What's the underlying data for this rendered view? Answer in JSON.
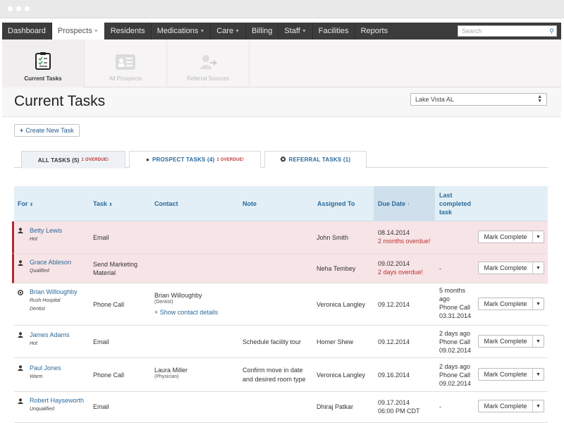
{
  "nav": {
    "items": [
      {
        "label": "Dashboard",
        "caret": false
      },
      {
        "label": "Prospects",
        "caret": true
      },
      {
        "label": "Residents",
        "caret": false
      },
      {
        "label": "Medications",
        "caret": true
      },
      {
        "label": "Care",
        "caret": true
      },
      {
        "label": "Billing",
        "caret": false
      },
      {
        "label": "Staff",
        "caret": true
      },
      {
        "label": "Facilities",
        "caret": false
      },
      {
        "label": "Reports",
        "caret": false
      }
    ],
    "search_placeholder": "Search"
  },
  "subnav": {
    "current_tasks": "Current Tasks",
    "all_prospects": "All Prospects",
    "referral_sources": "Referral Sources"
  },
  "header": {
    "title": "Current Tasks",
    "facility": "Lake Vista AL"
  },
  "create_button": "Create New Task",
  "tabs": {
    "all": {
      "label": "ALL TASKS (5)",
      "overdue": "1 OVERDUE!"
    },
    "prospect": {
      "label": "PROSPECT TASKS (4)",
      "overdue": "1 OVERDUE!"
    },
    "referral": {
      "label": "REFERRAL TASKS (1)"
    }
  },
  "table": {
    "headers": {
      "for": "For",
      "task": "Task",
      "contact": "Contact",
      "note": "Note",
      "assigned": "Assigned To",
      "due": "Due Date",
      "last1": "Last",
      "last2": "completed",
      "last3": "task"
    },
    "rows": [
      {
        "name": "Betty Lewis",
        "sub1": "Hot",
        "task1": "Email",
        "assigned": "John Smith",
        "due": "08.14.2014",
        "due_note": "2 months overdue!",
        "last": "",
        "action": "Mark Complete"
      },
      {
        "name": "Grace Ableson",
        "sub1": "Qualified",
        "task1": "Send Marketing",
        "task2": "Material",
        "assigned": "Neha Tembey",
        "due": "09.02.2014",
        "due_note": "2 days overdue!",
        "last": "-",
        "action": "Mark Complete"
      },
      {
        "name": "Brian Willoughby",
        "sub1": "Rush Hospital",
        "sub2": "Dentist",
        "task1": "Phone Call",
        "contact": "Brian Willoughby",
        "contact_role": "(Dentist)",
        "contact_link": "+ Show contact details",
        "assigned": "Veronica Langley",
        "due": "09.12.2014",
        "last1": "5 months",
        "last2": "ago",
        "last3": "Phone Call",
        "last4": "03.31.2014",
        "action": "Mark Complete"
      },
      {
        "name": "James Adams",
        "sub1": "Hot",
        "task1": "Email",
        "note1": "Schedule facility tour",
        "assigned": "Homer Shew",
        "due": "09.12.2014",
        "last1": "2 days ago",
        "last2": "Phone Call",
        "last3": "09.02.2014",
        "action": "Mark Complete"
      },
      {
        "name": "Paul Jones",
        "sub1": "Warm",
        "task1": "Phone Call",
        "contact": "Laura Miller",
        "contact_role": "(Physician)",
        "note1": "Confirm move in date",
        "note2": "and desired room type",
        "assigned": "Veronica Langley",
        "due": "09.16.2014",
        "last1": "2 days ago",
        "last2": "Phone Call",
        "last3": "09.02.2014",
        "action": "Mark Complete"
      },
      {
        "name": "Robert Hayseworth",
        "sub1": "Unqualified",
        "task1": "Email",
        "assigned": "Dhiraj Patkar",
        "due": "09.17.2014",
        "due_time": "06:00 PM CDT",
        "last": "-",
        "action": "Mark Complete"
      }
    ]
  }
}
